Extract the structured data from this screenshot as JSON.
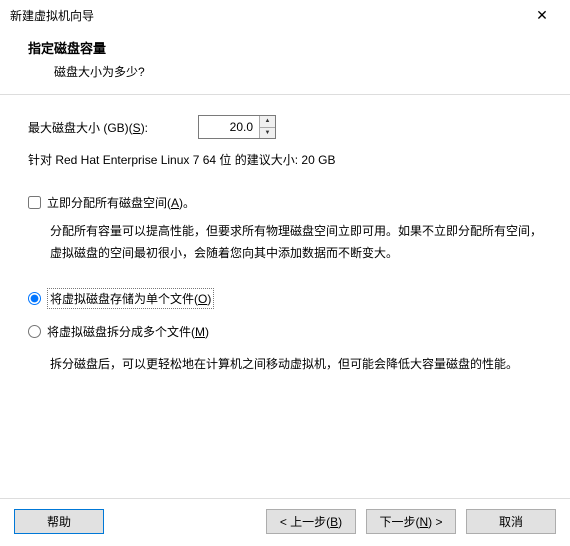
{
  "window": {
    "title": "新建虚拟机向导"
  },
  "header": {
    "heading": "指定磁盘容量",
    "subheading": "磁盘大小为多少?"
  },
  "size": {
    "label_pre": "最大磁盘大小 (GB)(",
    "label_key": "S",
    "label_post": "):",
    "value": "20.0"
  },
  "recommend": "针对 Red Hat Enterprise Linux 7 64 位 的建议大小: 20 GB",
  "allocate": {
    "label_pre": "立即分配所有磁盘空间(",
    "label_key": "A",
    "label_post": ")。",
    "desc": "分配所有容量可以提高性能，但要求所有物理磁盘空间立即可用。如果不立即分配所有空间，虚拟磁盘的空间最初很小，会随着您向其中添加数据而不断变大。"
  },
  "storage": {
    "single_pre": "将虚拟磁盘存储为单个文件(",
    "single_key": "O",
    "single_post": ")",
    "split_pre": "将虚拟磁盘拆分成多个文件(",
    "split_key": "M",
    "split_post": ")",
    "split_desc": "拆分磁盘后，可以更轻松地在计算机之间移动虚拟机，但可能会降低大容量磁盘的性能。"
  },
  "footer": {
    "help": "帮助",
    "back_pre": "< 上一步(",
    "back_key": "B",
    "back_post": ")",
    "next_pre": "下一步(",
    "next_key": "N",
    "next_post": ") >",
    "cancel": "取消"
  }
}
